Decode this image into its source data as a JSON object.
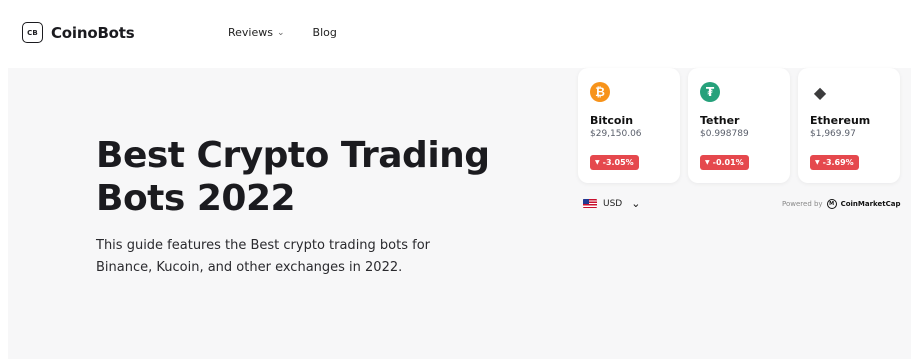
{
  "header": {
    "logo_badge": "CB",
    "logo_text": "CoinoBots",
    "nav": [
      {
        "label": "Reviews",
        "has_dropdown": true
      },
      {
        "label": "Blog",
        "has_dropdown": false
      }
    ]
  },
  "hero": {
    "title": "Best Crypto Trading Bots 2022",
    "description": "This guide features the Best crypto trading bots for Binance, Kucoin, and other exchanges in 2022."
  },
  "widget": {
    "coins": [
      {
        "name": "Bitcoin",
        "price": "$29,150.06",
        "change": "-3.05%",
        "icon": "bitcoin-icon",
        "icon_color": "#f7931a",
        "icon_glyph": "₿"
      },
      {
        "name": "Tether",
        "price": "$0.998789",
        "change": "-0.01%",
        "icon": "tether-icon",
        "icon_color": "#26a17b",
        "icon_glyph": "₮"
      },
      {
        "name": "Ethereum",
        "price": "$1,969.97",
        "change": "-3.69%",
        "icon": "ethereum-icon",
        "icon_color": "#3c3c3d",
        "icon_glyph": "◆"
      }
    ],
    "currency": "USD",
    "powered_by_label": "Powered by",
    "powered_by_name": "CoinMarketCap",
    "change_color": "#e5484d"
  }
}
